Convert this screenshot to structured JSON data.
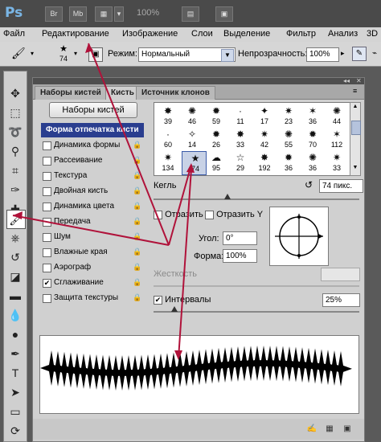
{
  "app": {
    "logo": "Ps",
    "top_buttons": [
      "Br",
      "Mb"
    ],
    "zoom": "100%",
    "extra_label": "3D"
  },
  "menubar": {
    "items": [
      "Файл",
      "Редактирование",
      "Изображение",
      "Слои",
      "Выделение",
      "Фильтр",
      "Анализ",
      "3D"
    ]
  },
  "options": {
    "brush_size": "74",
    "mode_label": "Режим:",
    "mode_value": "Нормальный",
    "opacity_label": "Непрозрачность:",
    "opacity_value": "100%"
  },
  "panel": {
    "tabs": [
      "Наборы кистей",
      "Кисть",
      "Источник клонов"
    ],
    "active_tab": "Кисть",
    "preset_button": "Наборы кистей",
    "options": [
      {
        "label": "Форма отпечатка кисти",
        "selected": true,
        "checked": null
      },
      {
        "label": "Динамика формы",
        "checked": false
      },
      {
        "label": "Рассеивание",
        "checked": false
      },
      {
        "label": "Текстура",
        "checked": false
      },
      {
        "label": "Двойная кисть",
        "checked": false
      },
      {
        "label": "Динамика цвета",
        "checked": false
      },
      {
        "label": "Передача",
        "checked": false
      },
      {
        "label": "Шум",
        "checked": false
      },
      {
        "label": "Влажные края",
        "checked": false
      },
      {
        "label": "Аэрограф",
        "checked": false
      },
      {
        "label": "Сглаживание",
        "checked": true
      },
      {
        "label": "Защита текстуры",
        "checked": false
      }
    ],
    "brushes": [
      {
        "glyph": "✸",
        "size": "39"
      },
      {
        "glyph": "✺",
        "size": "46"
      },
      {
        "glyph": "✹",
        "size": "59"
      },
      {
        "glyph": "·",
        "size": "11"
      },
      {
        "glyph": "✦",
        "size": "17"
      },
      {
        "glyph": "✷",
        "size": "23"
      },
      {
        "glyph": "✶",
        "size": "36"
      },
      {
        "glyph": "✺",
        "size": "44"
      },
      {
        "glyph": "·",
        "size": "60"
      },
      {
        "glyph": "✧",
        "size": "14"
      },
      {
        "glyph": "✹",
        "size": "26"
      },
      {
        "glyph": "✸",
        "size": "33"
      },
      {
        "glyph": "✷",
        "size": "42"
      },
      {
        "glyph": "✺",
        "size": "55"
      },
      {
        "glyph": "✹",
        "size": "70"
      },
      {
        "glyph": "✶",
        "size": "112"
      },
      {
        "glyph": "✷",
        "size": "134"
      },
      {
        "glyph": "★",
        "size": "74"
      },
      {
        "glyph": "☁",
        "size": "95"
      },
      {
        "glyph": "☆",
        "size": "29"
      },
      {
        "glyph": "✸",
        "size": "192"
      },
      {
        "glyph": "✹",
        "size": "36"
      },
      {
        "glyph": "✺",
        "size": "36"
      },
      {
        "glyph": "✷",
        "size": "33"
      }
    ],
    "selected_brush_size": "74",
    "size_label": "Кегль",
    "size_value": "74 пикс.",
    "flip_x": "Отразить X",
    "flip_y": "Отразить Y",
    "angle_label": "Угол:",
    "angle_value": "0°",
    "roundness_label": "Форма:",
    "roundness_value": "100%",
    "hardness_label": "Жесткость",
    "spacing_label": "Интервалы",
    "spacing_checked": true,
    "spacing_value": "25%"
  },
  "colors": {
    "selection": "#2a3e8f",
    "arrow": "#b0123a"
  }
}
